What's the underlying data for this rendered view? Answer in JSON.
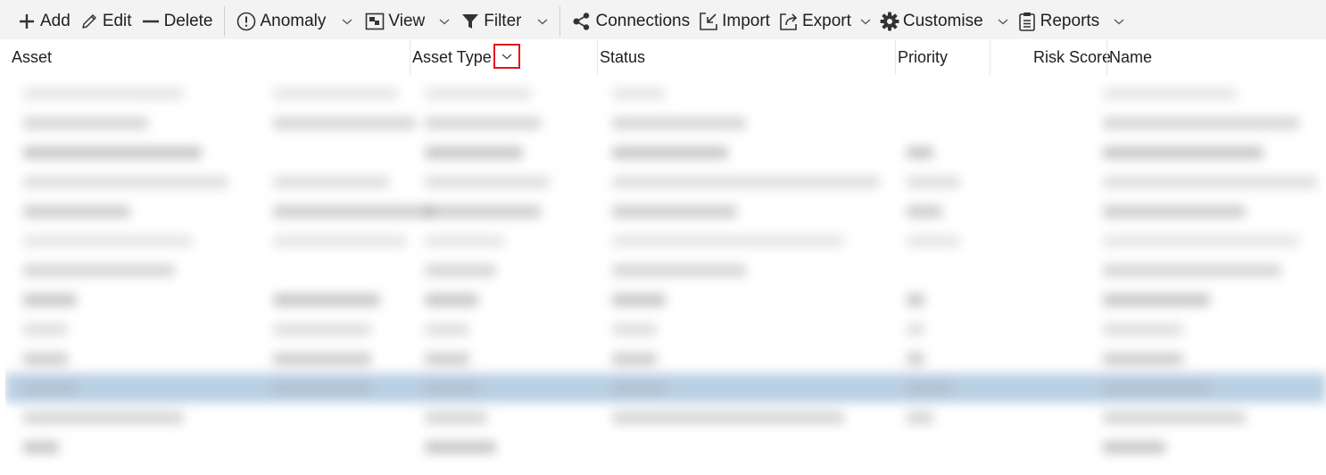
{
  "toolbar": {
    "add_label": "Add",
    "edit_label": "Edit",
    "delete_label": "Delete",
    "anomaly_label": "Anomaly",
    "view_label": "View",
    "filter_label": "Filter",
    "connections_label": "Connections",
    "import_label": "Import",
    "export_label": "Export",
    "customise_label": "Customise",
    "reports_label": "Reports"
  },
  "columns": {
    "asset": "Asset",
    "asset_type": "Asset Type",
    "status": "Status",
    "priority": "Priority",
    "risk_score": "Risk Score",
    "name": "Name"
  },
  "grid": {
    "selected_row_index": 10,
    "row_count": 13
  },
  "colors": {
    "toolbar_bg": "#f3f3f3",
    "highlight_border": "#e0151f",
    "selected_row": "#b9cfe3"
  }
}
